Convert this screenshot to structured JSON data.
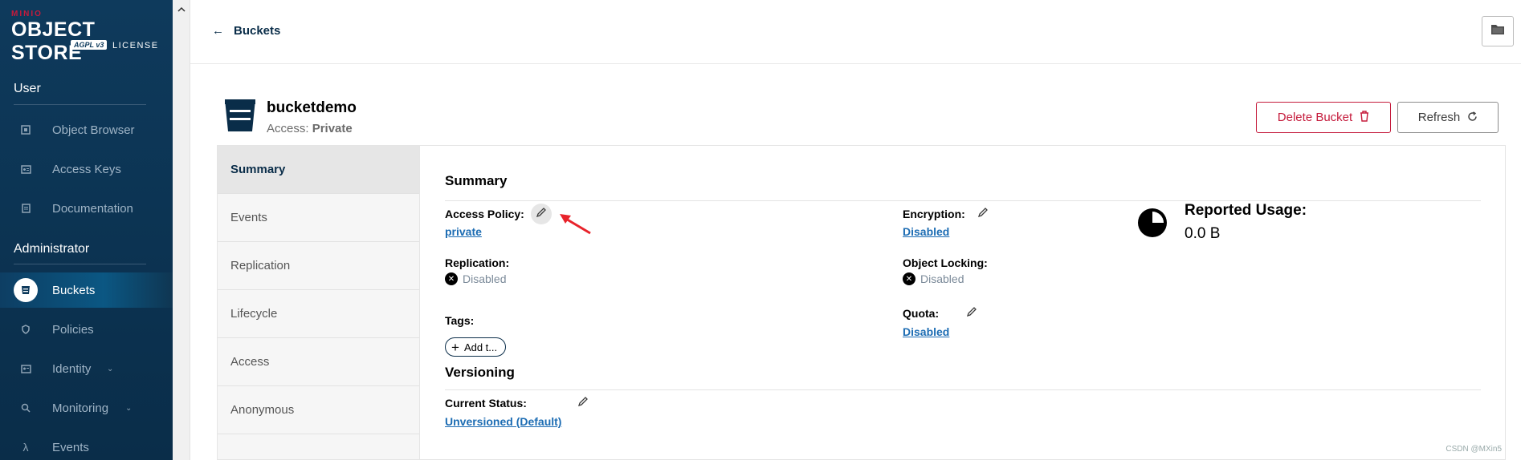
{
  "brand": {
    "minio": "MINIO",
    "product": "OBJECT STORE",
    "agpl": "AGPL v3",
    "license": "LICENSE"
  },
  "sidebar": {
    "sections": [
      {
        "title": "User",
        "items": [
          {
            "label": "Object Browser",
            "icon": "object-browser-icon"
          },
          {
            "label": "Access Keys",
            "icon": "access-keys-icon"
          },
          {
            "label": "Documentation",
            "icon": "documentation-icon"
          }
        ]
      },
      {
        "title": "Administrator",
        "items": [
          {
            "label": "Buckets",
            "icon": "buckets-icon",
            "active": true
          },
          {
            "label": "Policies",
            "icon": "policies-icon"
          },
          {
            "label": "Identity",
            "icon": "identity-icon",
            "expandable": true
          },
          {
            "label": "Monitoring",
            "icon": "monitoring-icon",
            "expandable": true
          },
          {
            "label": "Events",
            "icon": "lambda-icon"
          }
        ]
      }
    ]
  },
  "topbar": {
    "back_label": "Buckets"
  },
  "bucket": {
    "name": "bucketdemo",
    "access_prefix": "Access:",
    "access_value": "Private",
    "delete_label": "Delete Bucket",
    "refresh_label": "Refresh"
  },
  "tabs": [
    {
      "label": "Summary",
      "active": true
    },
    {
      "label": "Events"
    },
    {
      "label": "Replication"
    },
    {
      "label": "Lifecycle"
    },
    {
      "label": "Access"
    },
    {
      "label": "Anonymous"
    }
  ],
  "summary": {
    "title": "Summary",
    "access_policy_label": "Access Policy:",
    "access_policy_value": "private",
    "encryption_label": "Encryption:",
    "encryption_value": "Disabled",
    "replication_label": "Replication:",
    "replication_value": "Disabled",
    "object_locking_label": "Object Locking:",
    "object_locking_value": "Disabled",
    "tags_label": "Tags:",
    "add_tag_label": "Add t...",
    "quota_label": "Quota:",
    "quota_value": "Disabled",
    "reported_usage_label": "Reported Usage:",
    "reported_usage_value": "0.0 B"
  },
  "versioning": {
    "title": "Versioning",
    "current_status_label": "Current Status:",
    "current_status_value": "Unversioned (Default)"
  },
  "watermark": "CSDN @MXin5",
  "colors": {
    "sidebar": "#0e3a5c",
    "danger": "#c51b3c",
    "link": "#1c6cb3",
    "annotation_arrow": "#e8232b"
  }
}
